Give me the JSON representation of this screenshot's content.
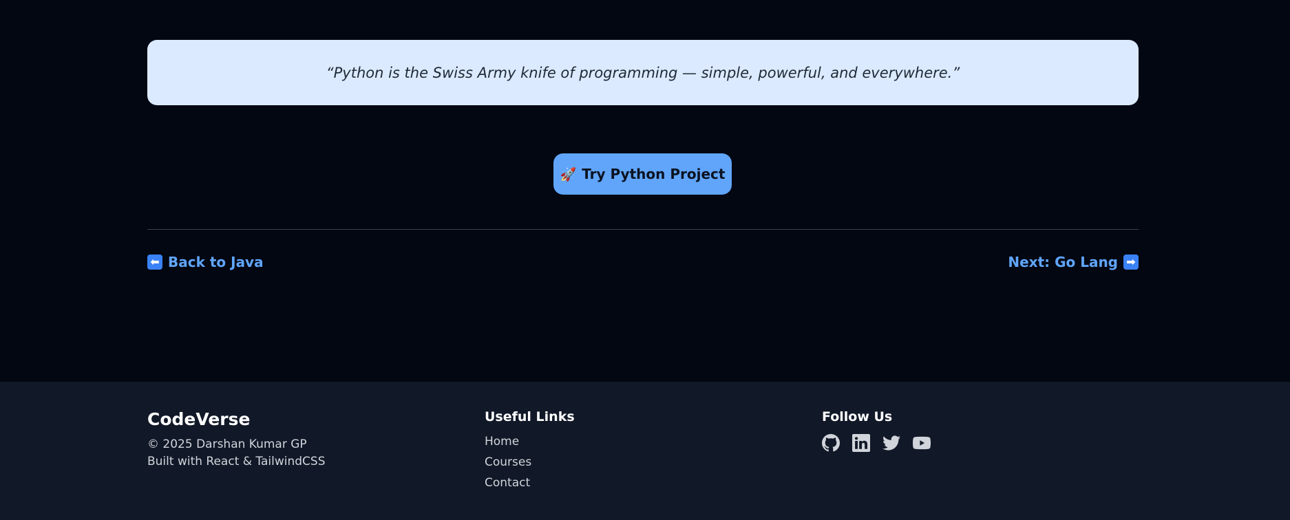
{
  "quote": {
    "text": "“Python is the Swiss Army knife of programming — simple, powerful, and everywhere.”"
  },
  "cta": {
    "icon": "rocket-icon",
    "icon_glyph": "🚀",
    "label": "Try Python Project"
  },
  "navigation": {
    "prev": {
      "icon": "arrow-left-icon",
      "glyph": "⬅",
      "label": "Back to Java"
    },
    "next": {
      "icon": "arrow-right-icon",
      "glyph": "➡",
      "label": "Next: Go Lang"
    }
  },
  "footer": {
    "brand": {
      "name": "CodeVerse",
      "copyright": "© 2025 Darshan Kumar GP",
      "built_with": "Built with React & TailwindCSS"
    },
    "useful_links": {
      "heading": "Useful Links",
      "items": [
        "Home",
        "Courses",
        "Contact"
      ]
    },
    "follow_us": {
      "heading": "Follow Us",
      "icons": [
        "github-icon",
        "linkedin-icon",
        "twitter-icon",
        "youtube-icon"
      ]
    }
  },
  "colors": {
    "background": "#030712",
    "footer_background": "#111827",
    "quote_background": "#dbeafe",
    "accent": "#60a5fa",
    "text_muted": "#d1d5db"
  }
}
